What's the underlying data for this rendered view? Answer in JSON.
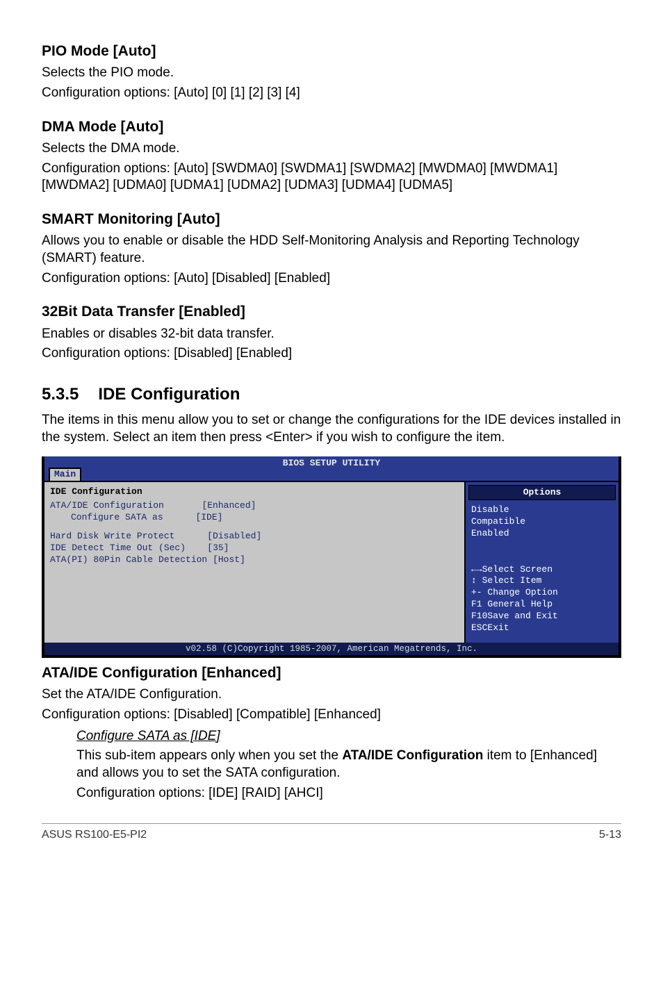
{
  "s1": {
    "h": "PIO Mode [Auto]",
    "p1": "Selects the PIO mode.",
    "p2": "Configuration options: [Auto] [0] [1] [2] [3] [4]"
  },
  "s2": {
    "h": "DMA Mode [Auto]",
    "p1": "Selects the DMA mode.",
    "p2": "Configuration options: [Auto] [SWDMA0] [SWDMA1] [SWDMA2] [MWDMA0] [MWDMA1] [MWDMA2] [UDMA0] [UDMA1] [UDMA2] [UDMA3] [UDMA4] [UDMA5]"
  },
  "s3": {
    "h": "SMART Monitoring [Auto]",
    "p1": "Allows you to enable or disable the HDD Self-Monitoring Analysis and Reporting Technology (SMART) feature.",
    "p2": "Configuration options: [Auto] [Disabled] [Enabled]"
  },
  "s4": {
    "h": "32Bit Data Transfer [Enabled]",
    "p1": "Enables or disables 32-bit data transfer.",
    "p2": "Configuration options: [Disabled] [Enabled]"
  },
  "subsection": {
    "num": "5.3.5",
    "title": "IDE Configuration"
  },
  "intro": "The items in this menu allow you to set or change the configurations for the IDE devices installed in the system. Select an item then press <Enter> if you wish to configure the item.",
  "bios": {
    "title": "BIOS SETUP UTILITY",
    "tab": "Main",
    "panel_header": "IDE Configuration",
    "rows": {
      "r1l": "ATA/IDE Configuration",
      "r1v": "[Enhanced]",
      "r2l": "Configure SATA as",
      "r2v": "[IDE]",
      "r3l": "Hard Disk Write Protect",
      "r3v": "[Disabled]",
      "r4l": "IDE Detect Time Out (Sec)",
      "r4v": "[35]",
      "r5l": "ATA(PI) 80Pin Cable Detection",
      "r5v": "[Host]"
    },
    "right": {
      "options_header": "Options",
      "opts": [
        "Disable",
        "Compatible",
        "Enabled"
      ],
      "help": {
        "l1": "Select Screen",
        "l2": " Select Item",
        "l3": "+- Change Option",
        "l4": "F1 General Help",
        "l5": "F10Save and Exit",
        "l6": "ESCExit"
      }
    },
    "footer": "v02.58 (C)Copyright 1985-2007, American Megatrends, Inc."
  },
  "s5": {
    "h": "ATA/IDE Configuration [Enhanced]",
    "p1": "Set the ATA/IDE Configuration.",
    "p2": "Configuration options: [Disabled] [Compatible] [Enhanced]"
  },
  "sub": {
    "h": "Configure SATA as [IDE]",
    "p1a": "This sub-item appears only when you set the ",
    "p1b": "ATA/IDE Configuration",
    "p1c": " item to [Enhanced] and allows you to set the SATA configuration.",
    "p2": "Configuration options: [IDE] [RAID] [AHCI]"
  },
  "footer": {
    "left": "ASUS RS100-E5-PI2",
    "right": "5-13"
  }
}
